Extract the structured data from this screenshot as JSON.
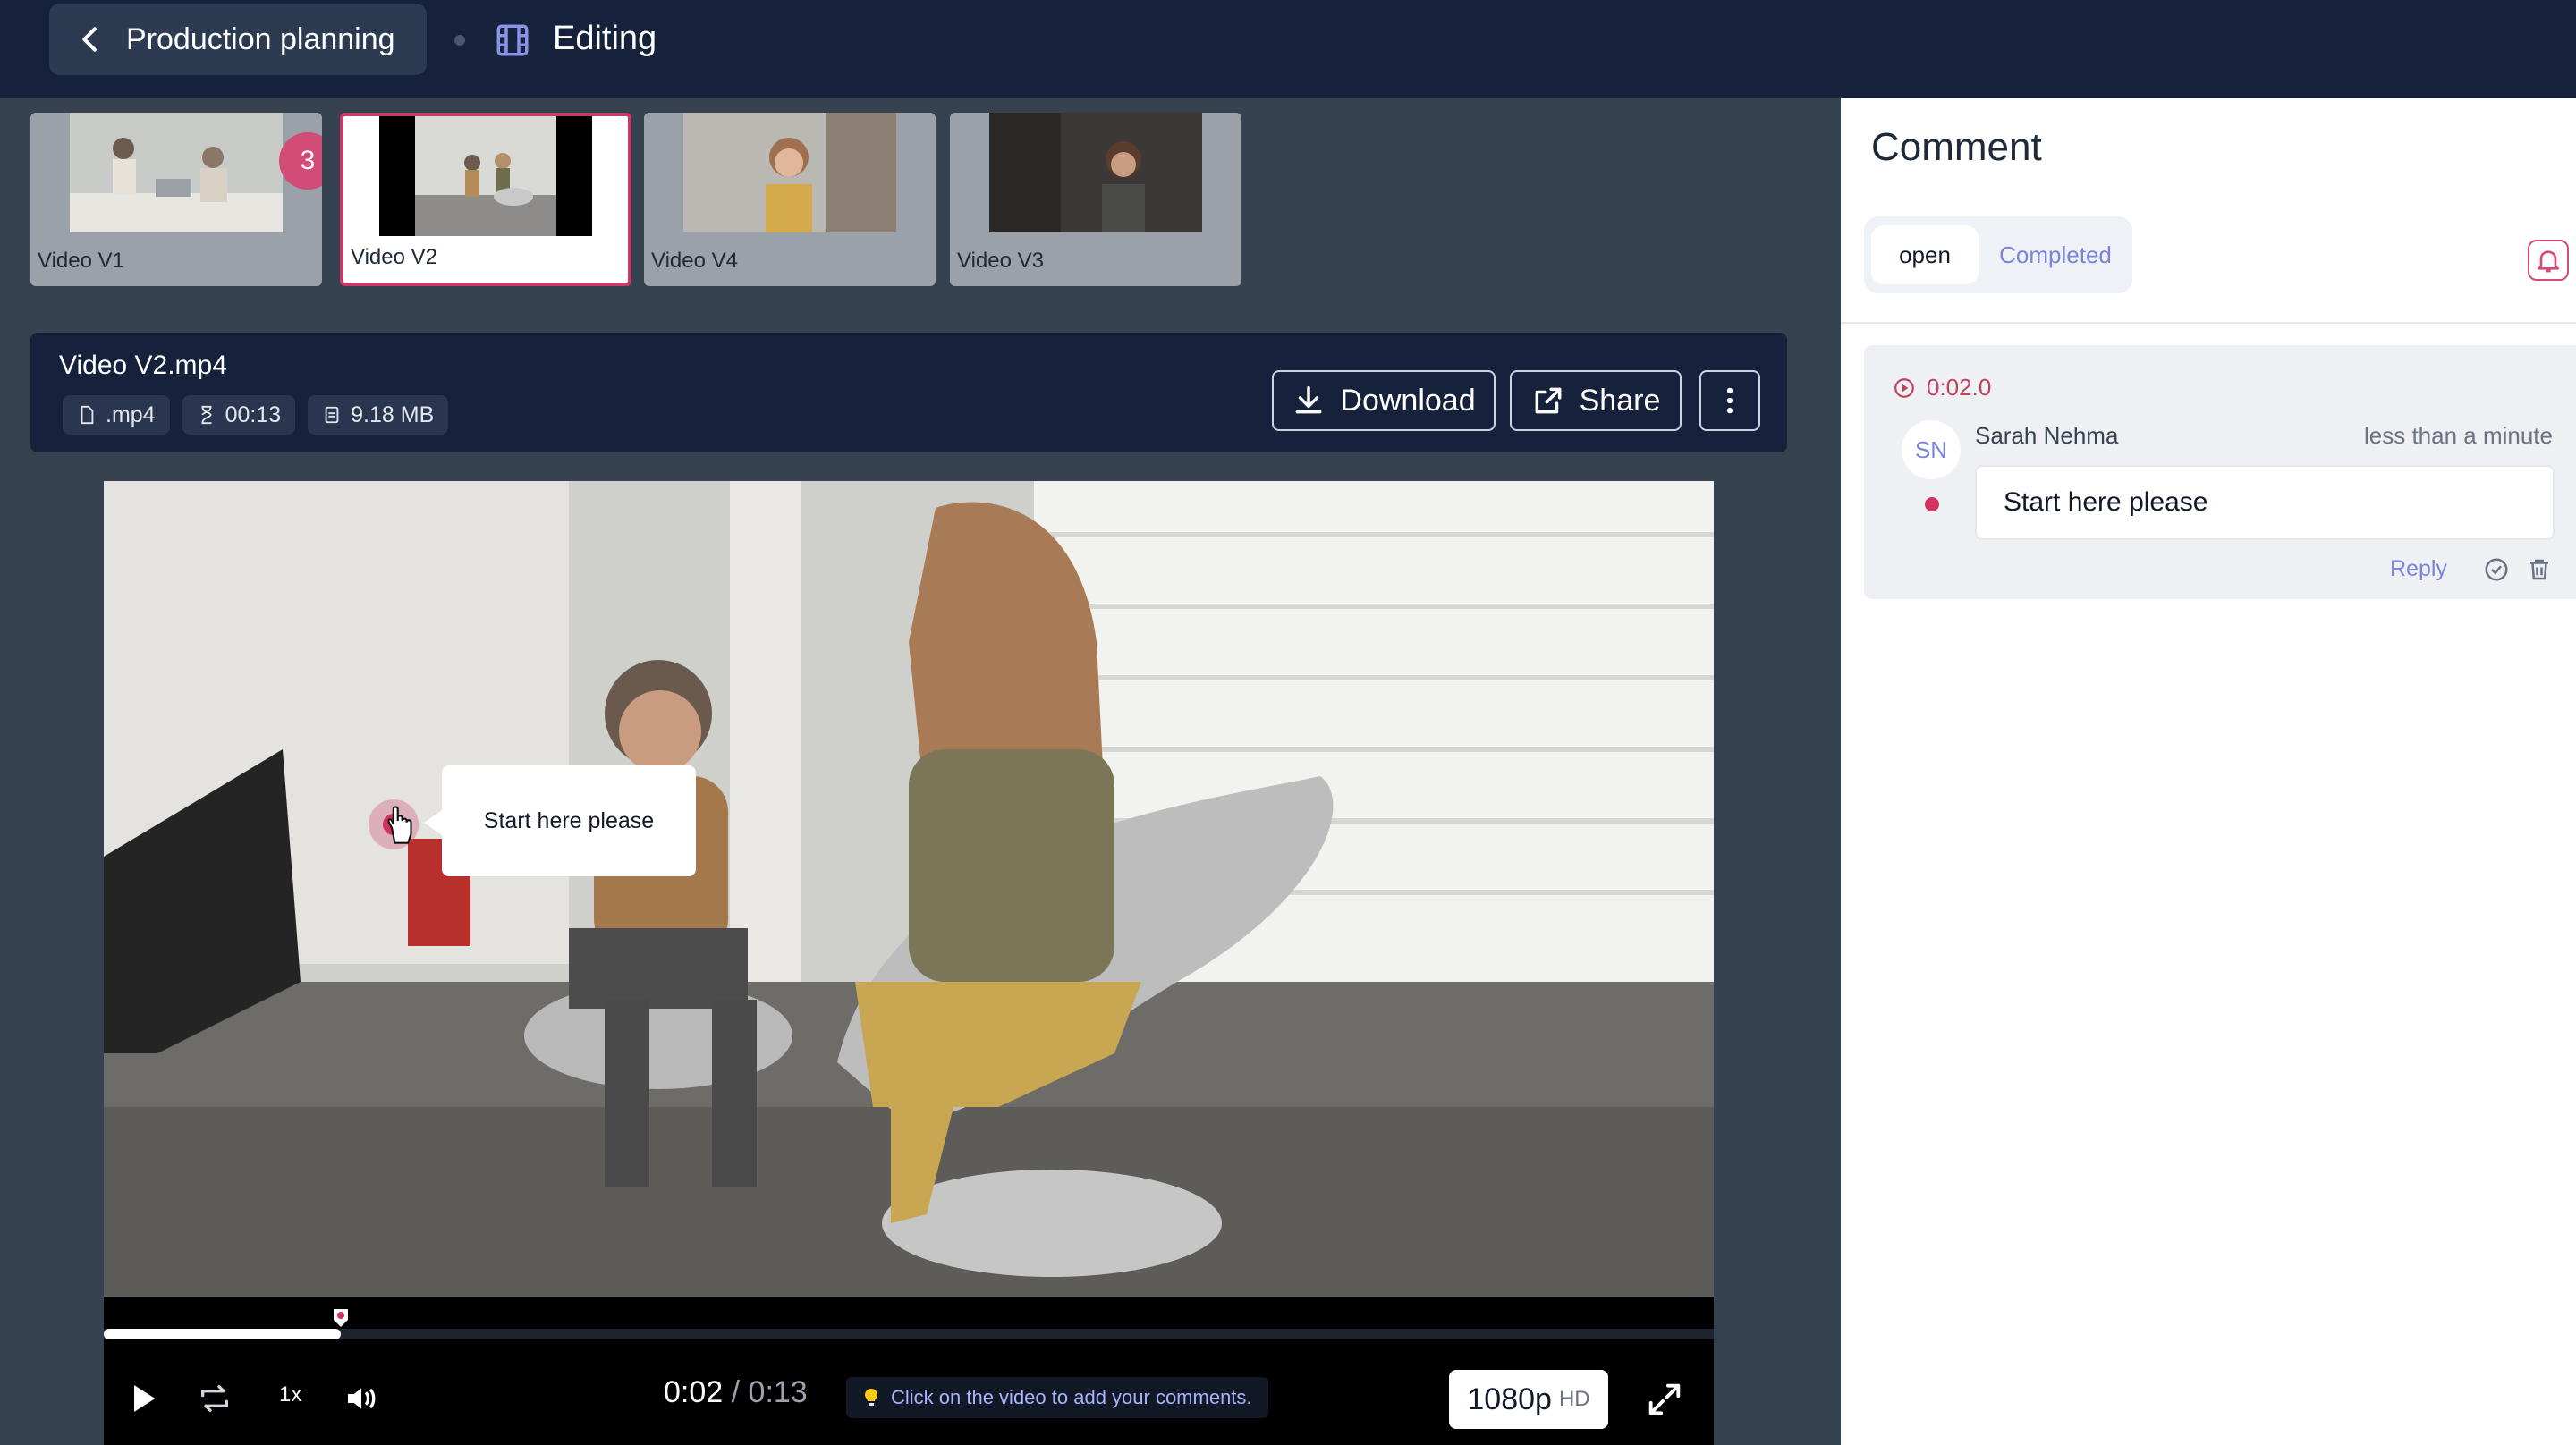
{
  "header": {
    "back_label": "Production planning",
    "section_label": "Editing"
  },
  "thumbnails": [
    {
      "label": "Video V1",
      "badge": "3",
      "active": false
    },
    {
      "label": "Video V2",
      "active": true
    },
    {
      "label": "Video V4",
      "active": false
    },
    {
      "label": "Video V3",
      "active": false
    }
  ],
  "file": {
    "title": "Video V2.mp4",
    "extension": ".mp4",
    "duration": "00:13",
    "size": "9.18 MB",
    "download_label": "Download",
    "share_label": "Share"
  },
  "player": {
    "annotation_text": "Start here please",
    "current_time": "0:02",
    "separator": " / ",
    "duration": "0:13",
    "progress_fraction": 0.147,
    "speed": "1x",
    "hint": "Click on the video to add your comments.",
    "quality": "1080p",
    "quality_badge": "HD"
  },
  "comments_panel": {
    "title": "Comment",
    "tab_open": "open",
    "tab_completed": "Completed",
    "comments": [
      {
        "timestamp": "0:02.0",
        "initials": "SN",
        "author": "Sarah Nehma",
        "when": "less than a minute",
        "text": "Start here please",
        "reply_label": "Reply"
      }
    ]
  },
  "colors": {
    "topbar": "#16223b",
    "main_bg": "#364250",
    "accent_pink": "#d14c77",
    "accent_purple": "#7c83d8"
  }
}
